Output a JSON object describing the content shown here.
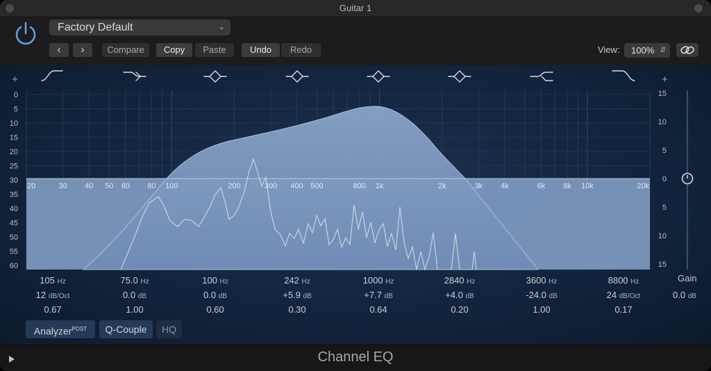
{
  "window": {
    "title": "Guitar 1"
  },
  "header": {
    "preset": "Factory Default",
    "compare_label": "Compare",
    "copy_label": "Copy",
    "paste_label": "Paste",
    "undo_label": "Undo",
    "redo_label": "Redo",
    "view_label": "View:",
    "view_value": "100%"
  },
  "freq_labels": [
    "20",
    "30",
    "40",
    "50",
    "60",
    "80",
    "100",
    "200",
    "300",
    "400",
    "500",
    "800",
    "1k",
    "2k",
    "3k",
    "4k",
    "6k",
    "8k",
    "10k",
    "20k"
  ],
  "left_scale": [
    "0",
    "5",
    "10",
    "15",
    "20",
    "25",
    "30",
    "35",
    "40",
    "45",
    "50",
    "55",
    "60"
  ],
  "right_scale": [
    "15",
    "10",
    "5",
    "0",
    "5",
    "10",
    "15"
  ],
  "bands": [
    {
      "freq": "105",
      "freq_unit": "Hz",
      "gain": "12",
      "gain_unit": "dB/Oct",
      "q": "0.67",
      "shape": "lowcut-icon"
    },
    {
      "freq": "75.0",
      "freq_unit": "Hz",
      "gain": "0.0",
      "gain_unit": "dB",
      "q": "1.00",
      "shape": "lowshelf-icon"
    },
    {
      "freq": "100",
      "freq_unit": "Hz",
      "gain": "0.0",
      "gain_unit": "dB",
      "q": "0.60",
      "shape": "bell-icon"
    },
    {
      "freq": "242",
      "freq_unit": "Hz",
      "gain": "+5.9",
      "gain_unit": "dB",
      "q": "0.30",
      "shape": "bell-icon"
    },
    {
      "freq": "1000",
      "freq_unit": "Hz",
      "gain": "+7.7",
      "gain_unit": "dB",
      "q": "0.64",
      "shape": "bell-icon"
    },
    {
      "freq": "2840",
      "freq_unit": "Hz",
      "gain": "+4.0",
      "gain_unit": "dB",
      "q": "0.20",
      "shape": "bell-icon"
    },
    {
      "freq": "3600",
      "freq_unit": "Hz",
      "gain": "-24.0",
      "gain_unit": "dB",
      "q": "1.00",
      "shape": "highshelf-icon"
    },
    {
      "freq": "8800",
      "freq_unit": "Hz",
      "gain": "24",
      "gain_unit": "dB/Oct",
      "q": "0.17",
      "shape": "highcut-icon"
    }
  ],
  "gain": {
    "label": "Gain",
    "value": "0.0",
    "unit": "dB"
  },
  "footer": {
    "analyzer_label": "Analyzer",
    "analyzer_sup": "POST",
    "qcouple_label": "Q-Couple",
    "hq_label": "HQ",
    "plugin_name": "Channel EQ"
  },
  "colors": {
    "curve_fill": "#7b96bd",
    "curve_line": "#a8bfdf",
    "analyzer_line": "#c9d3e0",
    "accent": "#6aa0e0"
  }
}
